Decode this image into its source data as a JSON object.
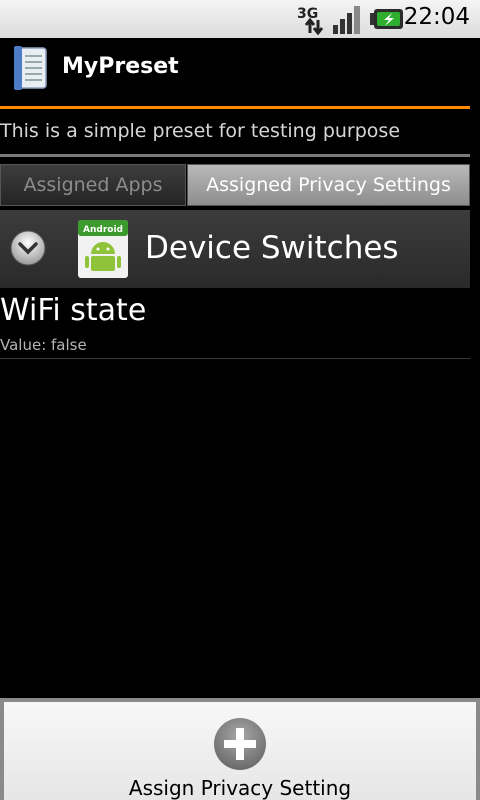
{
  "status_bar": {
    "network_type": "3G",
    "time": "22:04",
    "icons": [
      "3g-data-icon",
      "signal-strength-icon",
      "battery-charging-icon"
    ]
  },
  "app": {
    "title": "MyPreset",
    "icon": "notebook-icon"
  },
  "preset": {
    "description": "This is a simple preset for testing purpose"
  },
  "tabs": [
    {
      "label": "Assigned Apps",
      "selected": false
    },
    {
      "label": "Assigned Privacy Settings",
      "selected": true
    }
  ],
  "group": {
    "title": "Device Switches",
    "icon": "android-icon",
    "icon_badge": "Android",
    "expand_icon": "chevron-down-icon"
  },
  "setting": {
    "title": "WiFi state",
    "value": "Value: false"
  },
  "action": {
    "label": "Assign Privacy Setting",
    "icon": "plus-icon"
  },
  "colors": {
    "accent_line": "#ff8a00",
    "background": "#000000"
  }
}
